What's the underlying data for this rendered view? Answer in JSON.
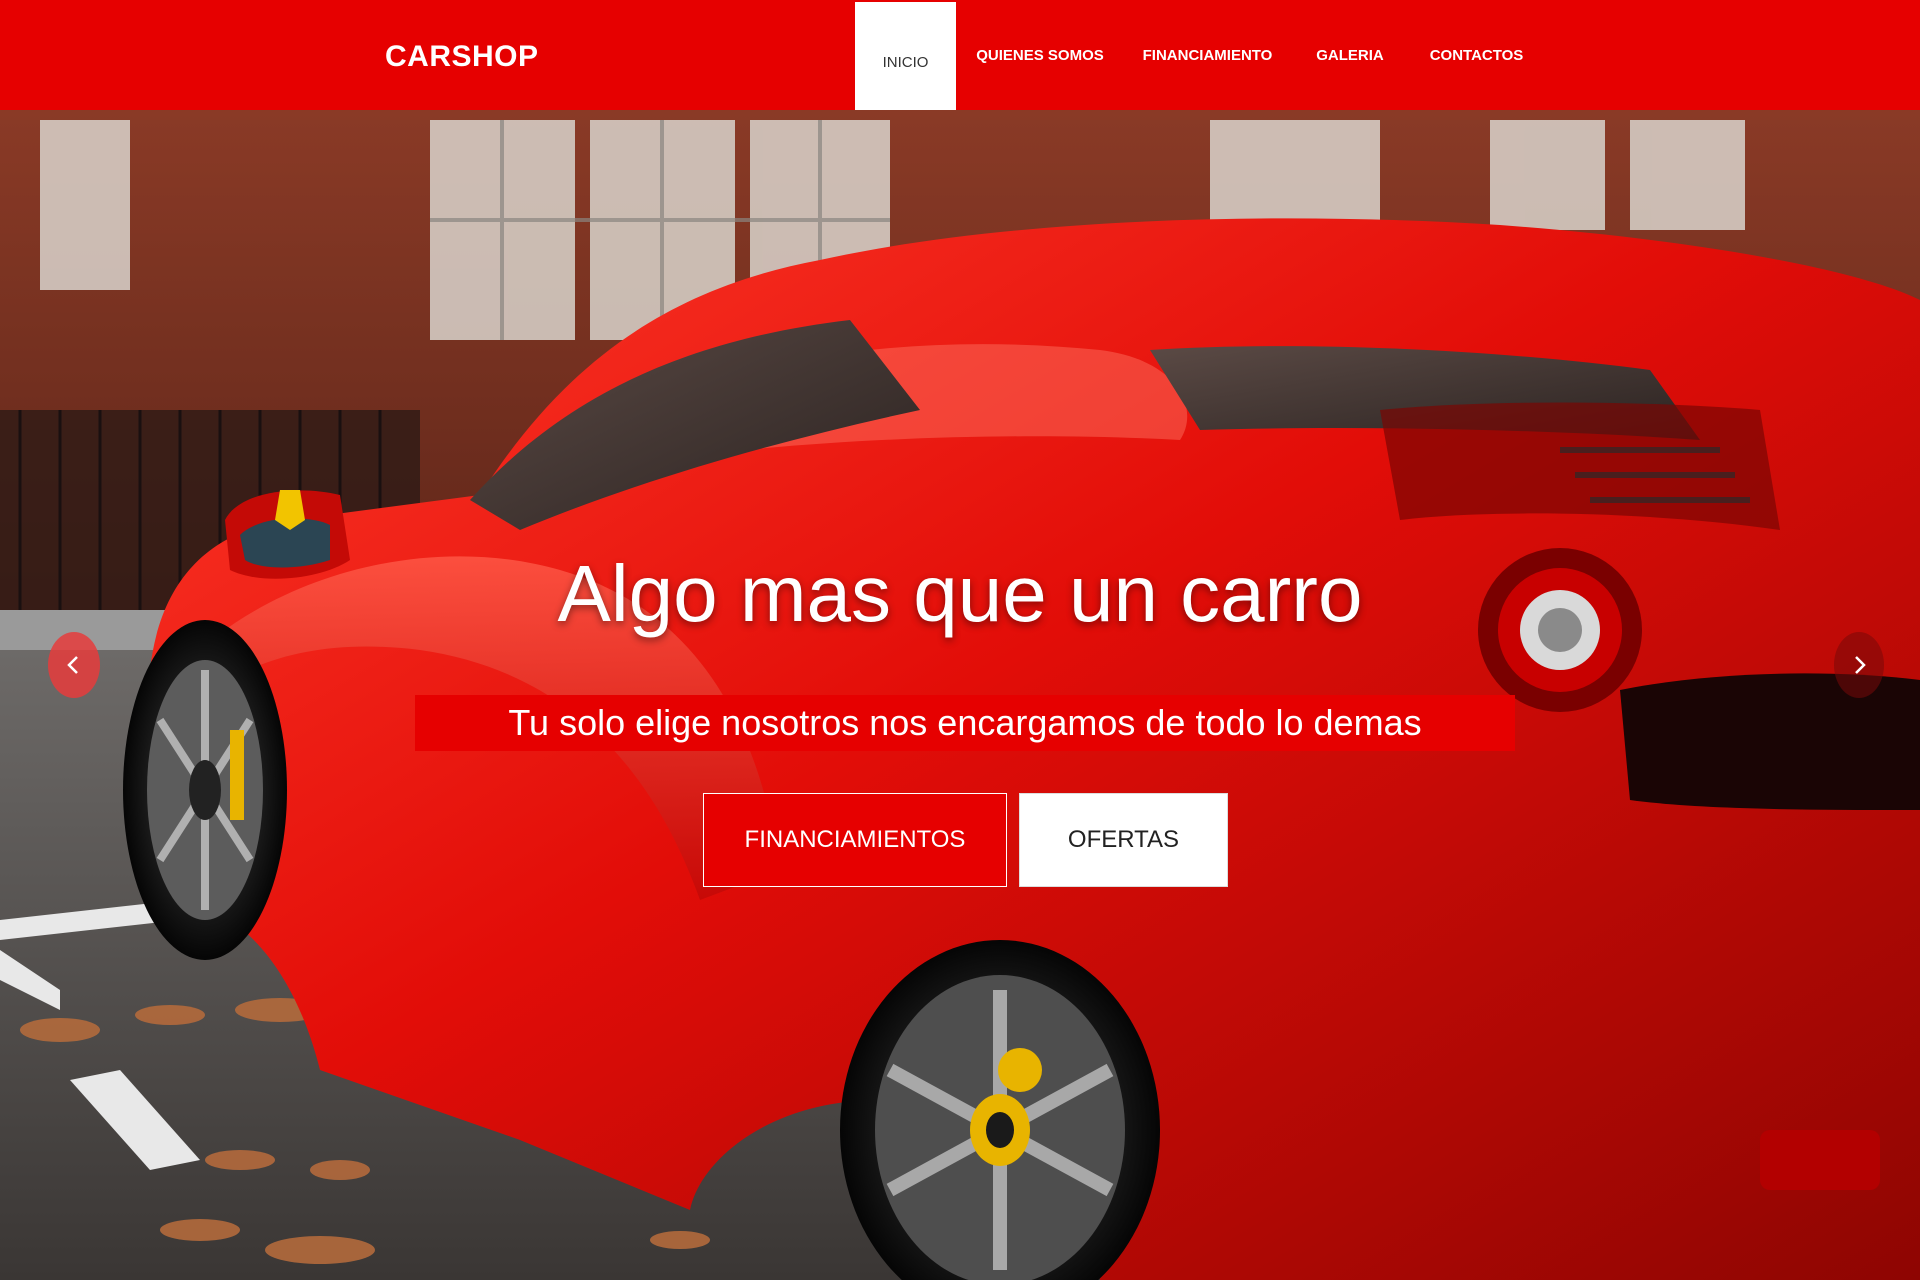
{
  "brand": "CARSHOP",
  "nav": {
    "items": [
      {
        "label": "INICIO",
        "active": true
      },
      {
        "label": "QUIENES SOMOS",
        "active": false
      },
      {
        "label": "FINANCIAMIENTO",
        "active": false
      },
      {
        "label": "GALERIA",
        "active": false
      },
      {
        "label": "CONTACTOS",
        "active": false
      }
    ]
  },
  "hero": {
    "title": "Algo mas que un carro",
    "subtitle": "Tu solo elige nosotros nos encargamos de todo lo demas",
    "buttons": {
      "primary": "FINANCIAMIENTOS",
      "secondary": "OFERTAS"
    },
    "prev_icon": "chevron-left-icon",
    "next_icon": "chevron-right-icon"
  },
  "colors": {
    "brand_red": "#e60000",
    "white": "#ffffff"
  }
}
